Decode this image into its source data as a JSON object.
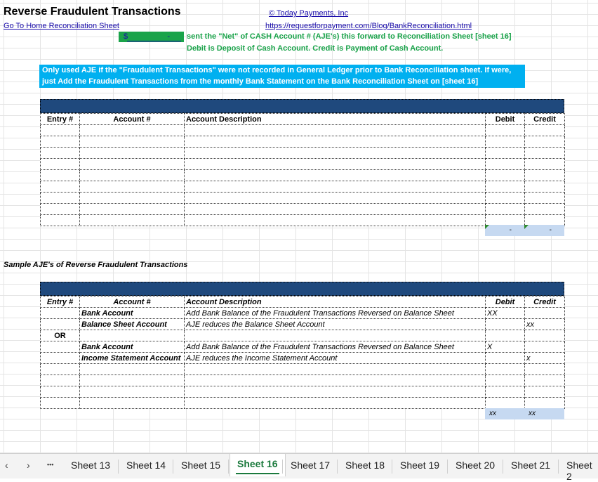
{
  "header": {
    "title": "Reverse Fraudulent Transactions",
    "home_link": "Go To Home Reconciliation Sheet",
    "company_link": "© Today Payments, Inc",
    "url_link": "https://requestforpayment.com/Blog/BankReconciliation.html"
  },
  "net_cash": {
    "currency": "$",
    "value": "-",
    "note_line1": "sent the \"Net\" of CASH Account # (AJE's) this forward to Reconciliation Sheet [sheet 16]",
    "note_line2": "Debit is Deposit of Cash Account.  Credit is Payment of Cash Account."
  },
  "instruction": {
    "line1": "Only used AJE if the \"Fraudulent Transactions\" were not recorded in General Ledger prior to Bank Reconciliation sheet.  If were,",
    "line2": "just Add the Fraudulent Transactions from the monthly Bank Statement on the Bank Reconciliation Sheet on [sheet 16]"
  },
  "table1": {
    "headers": {
      "entry": "Entry #",
      "account": "Account #",
      "description": "Account Description",
      "debit": "Debit",
      "credit": "Credit"
    },
    "totals": {
      "debit": "-",
      "credit": "-"
    }
  },
  "sample_title": "Sample AJE's of Reverse Fraudulent Transactions",
  "table2": {
    "headers": {
      "entry": "Entry #",
      "account": "Account #",
      "description": "Account Description",
      "debit": "Debit",
      "credit": "Credit"
    },
    "rows": [
      {
        "entry": "",
        "account": "Bank Account",
        "description": "Add Bank Balance of the Fraudulent Transactions Reversed on Balance Sheet",
        "debit": "XX",
        "credit": ""
      },
      {
        "entry": "",
        "account": "Balance Sheet Account",
        "description": "AJE reduces the Balance Sheet Account",
        "debit": "",
        "credit": "xx"
      },
      {
        "entry": "OR",
        "account": "",
        "description": "",
        "debit": "",
        "credit": ""
      },
      {
        "entry": "",
        "account": "Bank Account",
        "description": "Add Bank Balance of the Fraudulent Transactions Reversed on Balance Sheet",
        "debit": "X",
        "credit": ""
      },
      {
        "entry": "",
        "account": "Income Statement Account",
        "description": "AJE reduces the Income Statement Account",
        "debit": "",
        "credit": "x"
      }
    ],
    "totals": {
      "debit": "xx",
      "credit": "xx"
    }
  },
  "tabs": {
    "prev_icon": "chevron-left-icon",
    "next_icon": "chevron-right-icon",
    "more_label": "•••",
    "prev_label": "‹",
    "next_label": "›",
    "items": [
      "Sheet 13",
      "Sheet 14",
      "Sheet 15",
      "Sheet 16",
      "Sheet 17",
      "Sheet 18",
      "Sheet 19",
      "Sheet 20",
      "Sheet 21",
      "Sheet 2"
    ],
    "active": "Sheet 16"
  },
  "colors": {
    "accent_green": "#1aa34a",
    "instruction_cyan": "#00b0f0",
    "header_navy": "#1f497d",
    "total_blue": "#c6d9f1",
    "active_tab": "#1b7a3d"
  }
}
